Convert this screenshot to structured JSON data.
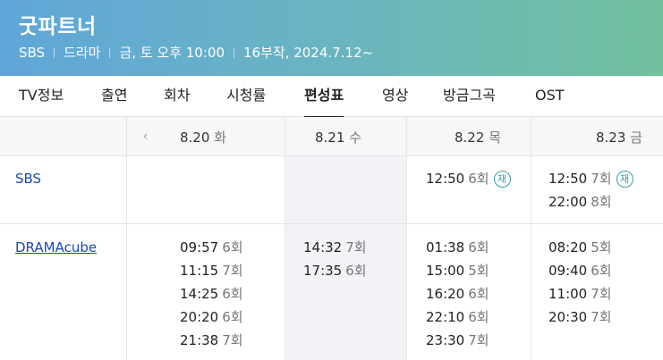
{
  "header": {
    "title": "굿파트너",
    "broadcaster": "SBS",
    "genre": "드라마",
    "airtime": "금, 토 오후 10:00",
    "info": "16부작, 2024.7.12~"
  },
  "tabs": [
    "TV정보",
    "출연",
    "회차",
    "시청률",
    "편성표",
    "영상",
    "방금그곡",
    "OST"
  ],
  "active_tab": "편성표",
  "dates": [
    {
      "date": "8.20",
      "day": "화"
    },
    {
      "date": "8.21",
      "day": "수"
    },
    {
      "date": "8.22",
      "day": "목"
    },
    {
      "date": "8.23",
      "day": "금"
    }
  ],
  "rerun_badge": "재",
  "channels": [
    {
      "name": "SBS",
      "days": [
        [],
        [],
        [
          {
            "time": "12:50",
            "ep": "6회",
            "rerun": true
          }
        ],
        [
          {
            "time": "12:50",
            "ep": "7회",
            "rerun": true
          },
          {
            "time": "22:00",
            "ep": "8회",
            "rerun": false
          }
        ]
      ]
    },
    {
      "name": "DRAMAcube",
      "days": [
        [
          {
            "time": "09:57",
            "ep": "6회"
          },
          {
            "time": "11:15",
            "ep": "7회"
          },
          {
            "time": "14:25",
            "ep": "6회"
          },
          {
            "time": "20:20",
            "ep": "6회"
          },
          {
            "time": "21:38",
            "ep": "7회"
          }
        ],
        [
          {
            "time": "14:32",
            "ep": "7회"
          },
          {
            "time": "17:35",
            "ep": "6회"
          }
        ],
        [
          {
            "time": "01:38",
            "ep": "6회"
          },
          {
            "time": "15:00",
            "ep": "5회"
          },
          {
            "time": "16:20",
            "ep": "6회"
          },
          {
            "time": "22:10",
            "ep": "6회"
          },
          {
            "time": "23:30",
            "ep": "7회"
          }
        ],
        [
          {
            "time": "08:20",
            "ep": "5회"
          },
          {
            "time": "09:40",
            "ep": "6회"
          },
          {
            "time": "11:00",
            "ep": "7회"
          },
          {
            "time": "20:30",
            "ep": "7회"
          }
        ]
      ]
    }
  ]
}
